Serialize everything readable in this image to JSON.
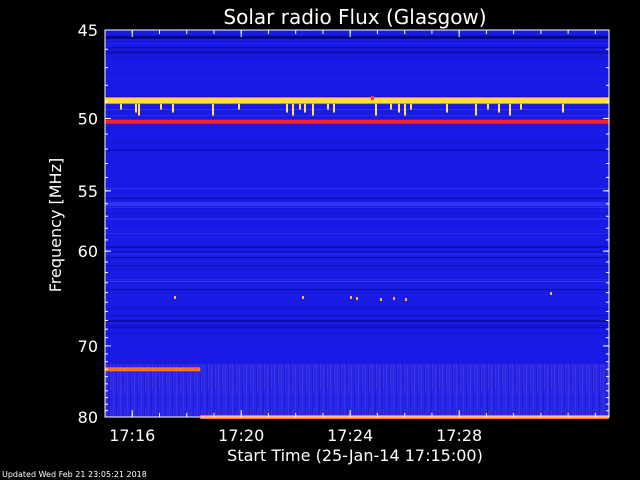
{
  "chart_data": {
    "type": "heatmap",
    "title": "Solar radio Flux (Glasgow)",
    "xlabel": "Start Time (25-Jan-14 17:15:00)",
    "ylabel": "Frequency [MHz]",
    "x_ticks": [
      "17:16",
      "17:20",
      "17:24",
      "17:28"
    ],
    "y_ticks": [
      45,
      50,
      55,
      60,
      70,
      80
    ],
    "xlim": [
      "17:15:00",
      "17:33:30"
    ],
    "ylim": [
      45,
      80
    ],
    "y_scale": "reciprocal",
    "grid": false,
    "colormap": "blue-red-yellow",
    "background_color": "#1a1ae6",
    "features": [
      {
        "kind": "continuous-band",
        "frequency_mhz": 48.9,
        "time_start": "17:15:00",
        "time_end": "17:33:30",
        "color": "#ffe040"
      },
      {
        "kind": "continuous-band",
        "frequency_mhz": 50.2,
        "time_start": "17:15:00",
        "time_end": "17:33:30",
        "color": "#ff2020"
      },
      {
        "kind": "continuous-band",
        "frequency_mhz": 73.0,
        "time_start": "17:15:00",
        "time_end": "17:18:30",
        "color": "#ff7020"
      },
      {
        "kind": "continuous-band",
        "frequency_mhz": 80.0,
        "time_start": "17:18:30",
        "time_end": "17:33:30",
        "color": "#ff7020"
      }
    ]
  },
  "footer": {
    "updated": "Updated Wed Feb 21 23:05:21 2018"
  }
}
